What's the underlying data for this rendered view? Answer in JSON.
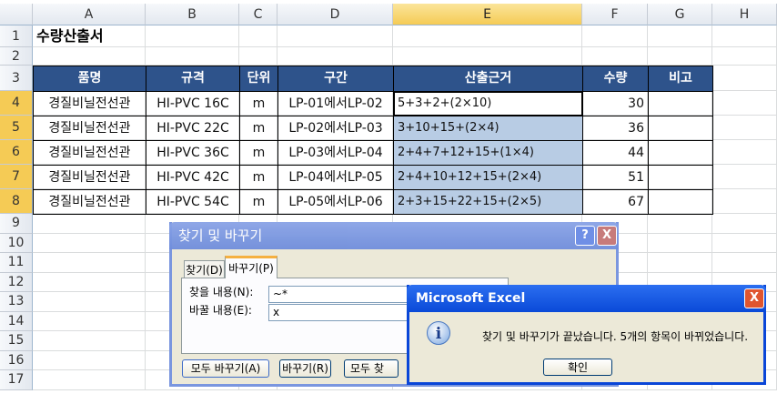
{
  "columns": [
    "A",
    "B",
    "C",
    "D",
    "E",
    "F",
    "G",
    "H"
  ],
  "rows": [
    "1",
    "2",
    "3",
    "4",
    "5",
    "6",
    "7",
    "8",
    "9",
    "10",
    "11",
    "12",
    "13",
    "14",
    "15",
    "16",
    "17"
  ],
  "title": "수량산출서",
  "headers": [
    "품명",
    "규격",
    "단위",
    "구간",
    "산출근거",
    "수량",
    "비고"
  ],
  "data": [
    [
      "경질비닐전선관",
      "HI-PVC 16C",
      "m",
      "LP-01에서LP-02",
      "5+3+2+(2×10)",
      "30",
      ""
    ],
    [
      "경질비닐전선관",
      "HI-PVC 22C",
      "m",
      "LP-02에서LP-03",
      "3+10+15+(2×4)",
      "36",
      ""
    ],
    [
      "경질비닐전선관",
      "HI-PVC 36C",
      "m",
      "LP-03에서LP-04",
      "2+4+7+12+15+(1×4)",
      "44",
      ""
    ],
    [
      "경질비닐전선관",
      "HI-PVC 42C",
      "m",
      "LP-04에서LP-05",
      "2+4+10+12+15+(2×4)",
      "51",
      ""
    ],
    [
      "경질비닐전선관",
      "HI-PVC 54C",
      "m",
      "LP-05에서LP-06",
      "2+3+15+22+15+(2×5)",
      "67",
      ""
    ]
  ],
  "find_dialog": {
    "title": "찾기 및 바꾸기",
    "help": "?",
    "close": "X",
    "tabs": [
      "찾기(D)",
      "바꾸기(P)"
    ],
    "find_label": "찾을 내용(N):",
    "find_value": "~*",
    "replace_label": "바꿀 내용(E):",
    "replace_value": "x",
    "buttons": [
      "모두 바꾸기(A)",
      "바꾸기(R)",
      "모두 찾"
    ]
  },
  "msgbox": {
    "title": "Microsoft Excel",
    "close": "X",
    "message": "찾기 및 바꾸기가 끝났습니다. 5개의 항목이 바뀌었습니다.",
    "ok": "확인",
    "icon": "i"
  }
}
